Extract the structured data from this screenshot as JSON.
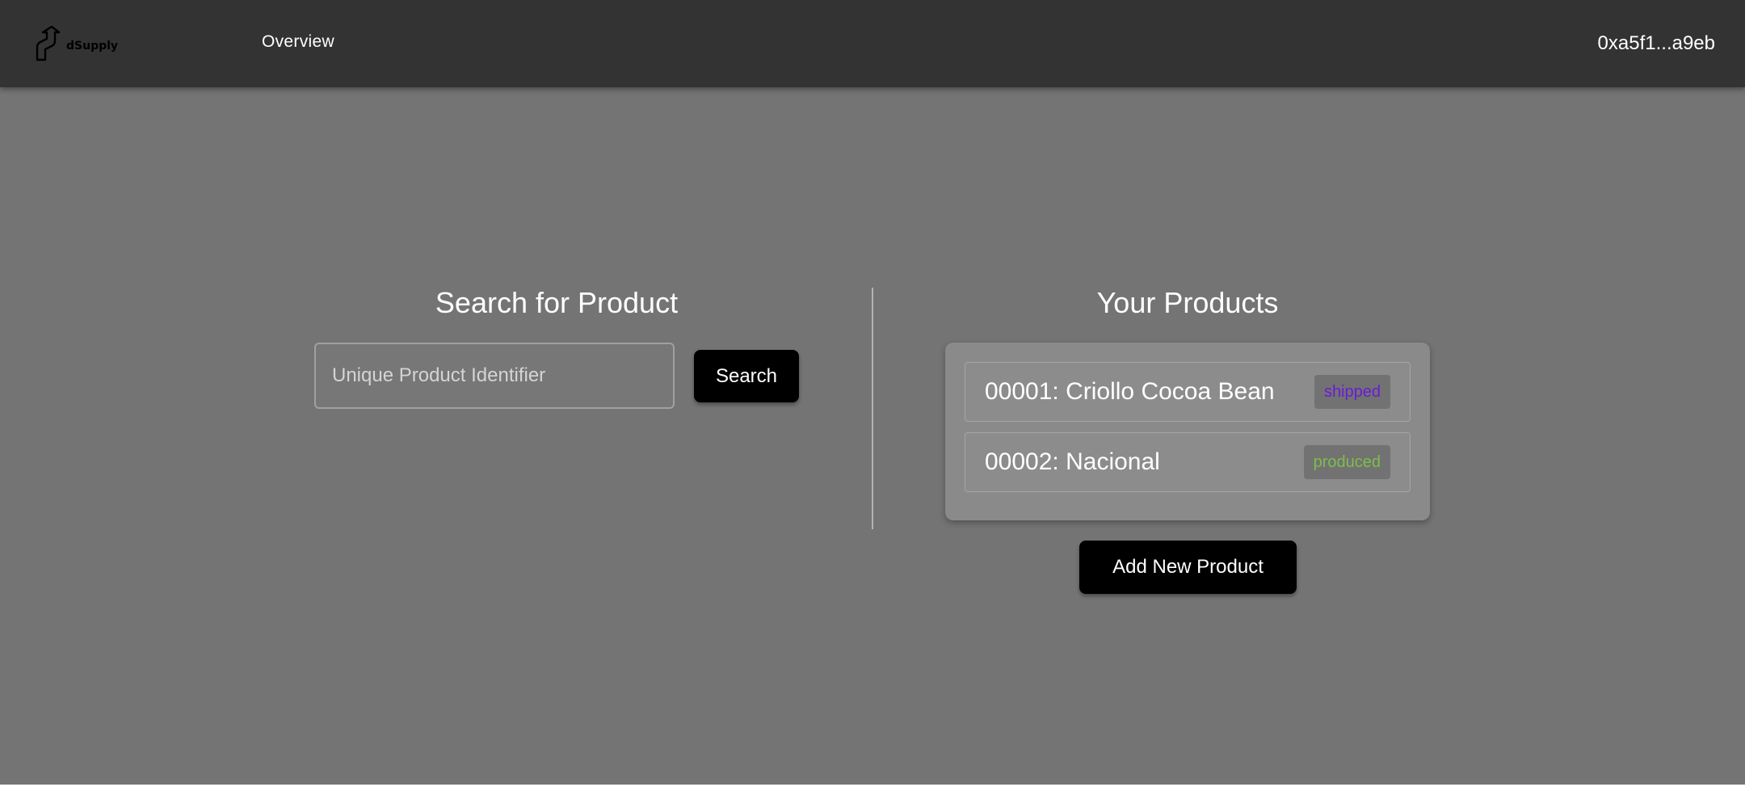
{
  "header": {
    "logo_text": "dSupply",
    "logo_icon": "upward-arrow-logo-icon",
    "nav_overview": "Overview",
    "account": "0xa5f1...a9eb"
  },
  "search": {
    "title": "Search for Product",
    "placeholder": "Unique Product Identifier",
    "value": "",
    "button_label": "Search"
  },
  "products": {
    "title": "Your Products",
    "items": [
      {
        "label": "00001: Criollo Cocoa Bean",
        "status": "shipped",
        "status_color": "#6a1bd6"
      },
      {
        "label": "00002: Nacional",
        "status": "produced",
        "status_color": "#7cbf4a"
      }
    ],
    "add_button_label": "Add New Product"
  },
  "colors": {
    "topbar": "#333333",
    "background": "#747474",
    "button": "#000000"
  }
}
